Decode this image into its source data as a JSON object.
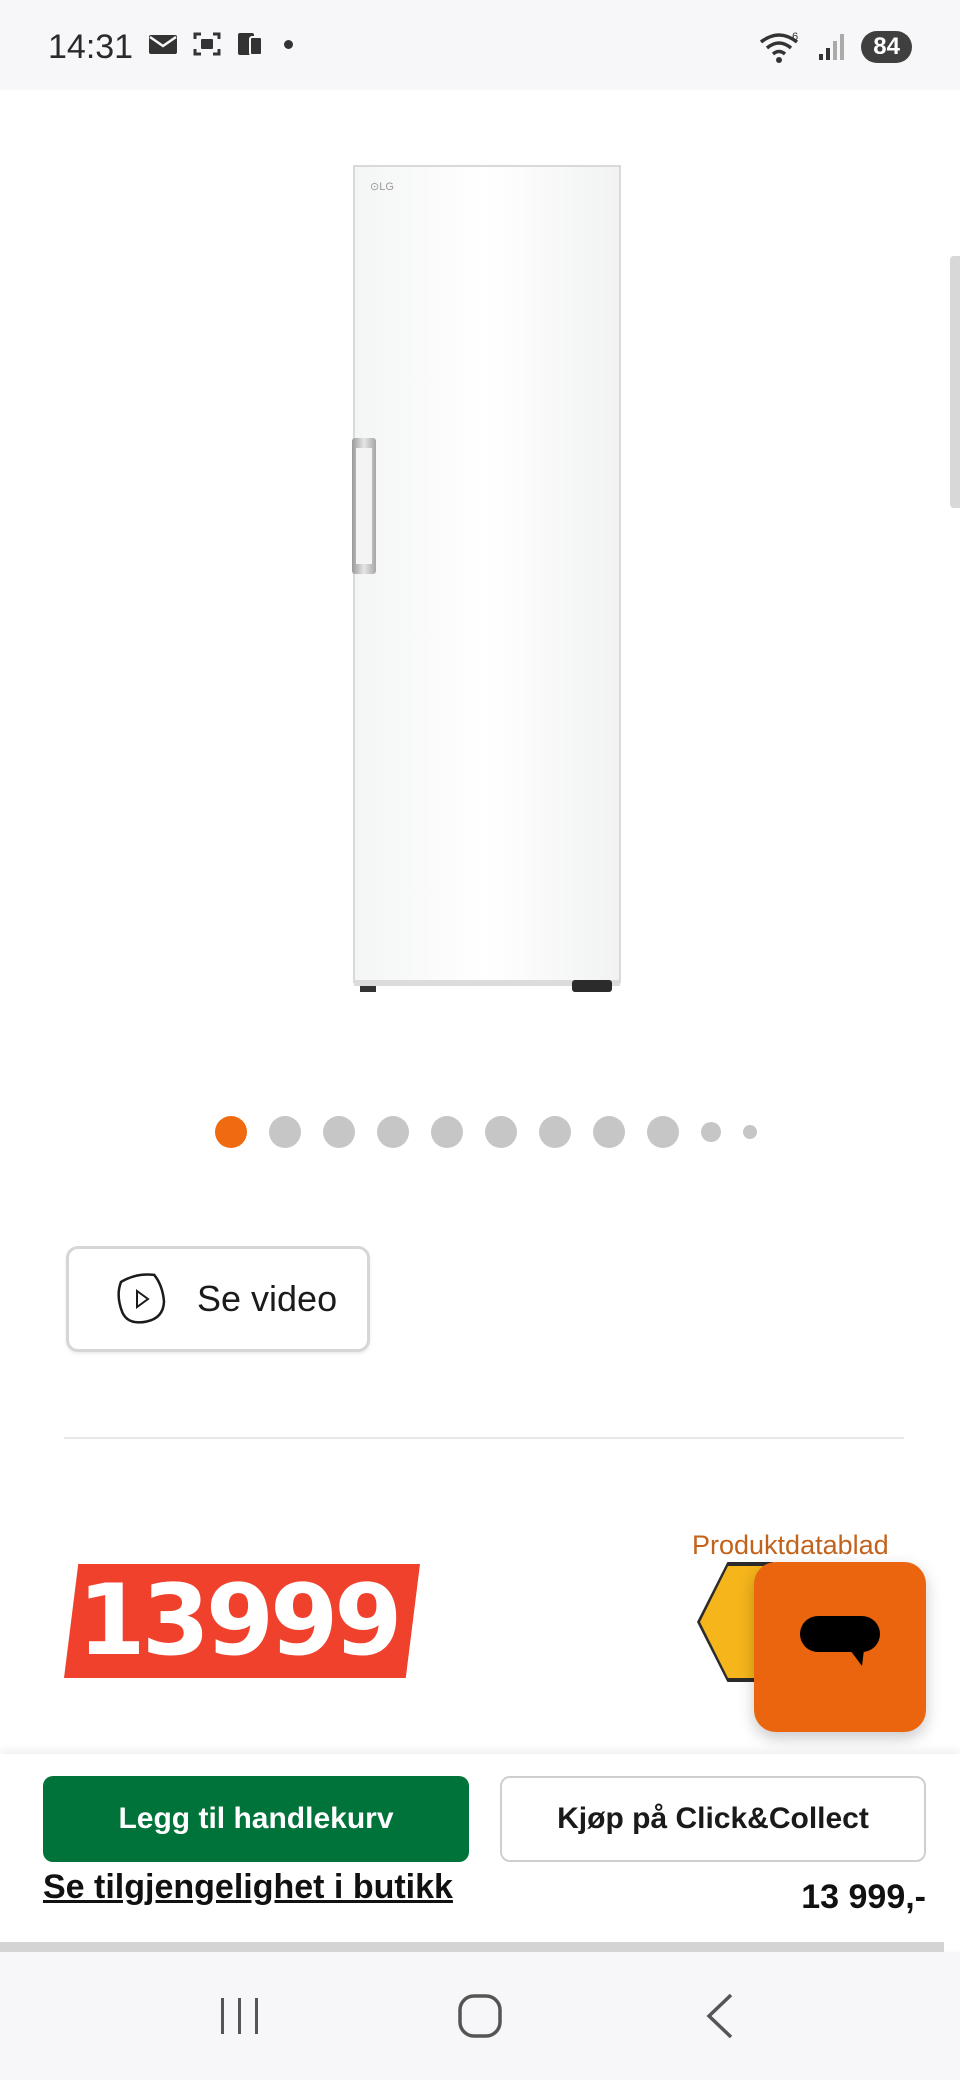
{
  "status_bar": {
    "time": "14:31",
    "battery": "84",
    "wifi_label": "6"
  },
  "product": {
    "image_alt": "LG white tall fridge",
    "brand_mark": "LG",
    "carousel": {
      "total_dots": 11,
      "active_index": 0
    }
  },
  "video_button": {
    "label": "Se video"
  },
  "price": {
    "big_price": "13999",
    "datasheet_label": "Produktdatablad"
  },
  "actions": {
    "add_to_cart": "Legg til handlekurv",
    "click_collect": "Kjøp på Click&Collect",
    "availability": "Se tilgjengelighet i butikk",
    "price_summary": "13 999,-"
  },
  "colors": {
    "accent_orange": "#ea650d",
    "price_red": "#f0412d",
    "cart_green": "#00733a",
    "energy_yellow": "#f5b51b"
  }
}
